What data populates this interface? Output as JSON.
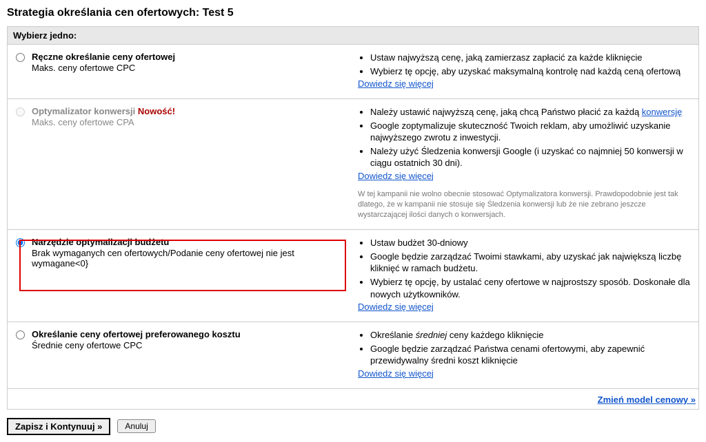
{
  "page_title": "Strategia określania cen ofertowych: Test 5",
  "panel_header": "Wybierz jedno:",
  "options": [
    {
      "heading": "Ręczne określanie ceny ofertowej",
      "sub": "Maks. ceny ofertowe CPC",
      "bullets": [
        "Ustaw najwyższą cenę, jaką zamierzasz zapłacić za każde kliknięcie",
        "Wybierz tę opcję, aby uzyskać maksymalną kontrolę nad każdą ceną ofertową"
      ],
      "learn_more": "Dowiedz się więcej"
    },
    {
      "heading": "Optymalizator konwersji",
      "new_badge": "Nowość!",
      "sub": "Maks. ceny ofertowe CPA",
      "bullet_pre": "Należy ustawić najwyższą cenę, jaką chcą Państwo płacić za każdą ",
      "bullet_link": "konwersję",
      "bullets_rest": [
        "Google zoptymalizuje skuteczność Twoich reklam, aby umożliwić uzyskanie najwyższego zwrotu z inwestycji.",
        "Należy użyć Śledzenia konwersji Google (i uzyskać co najmniej 50 konwersji w ciągu ostatnich 30 dni)."
      ],
      "learn_more": "Dowiedz się więcej",
      "note": "W tej kampanii nie wolno obecnie stosować Optymalizatora konwersji. Prawdopodobnie jest tak dlatego, że w kampanii nie stosuje się Śledzenia konwersji lub że nie zebrano jeszcze wystarczającej ilości danych o konwersjach."
    },
    {
      "heading": "Narzędzie optymalizacji budżetu",
      "sub": "Brak wymaganych cen ofertowych/Podanie ceny ofertowej nie jest wymagane<0}",
      "bullets": [
        "Ustaw budżet 30-dniowy",
        "Google będzie zarządzać Twoimi stawkami, aby uzyskać jak największą liczbę kliknięć w ramach budżetu.",
        "Wybierz tę opcję, by ustalać ceny ofertowe w najprostszy sposób. Doskonałe dla nowych użytkowników."
      ],
      "learn_more": "Dowiedz się więcej"
    },
    {
      "heading": "Określanie ceny ofertowej preferowanego kosztu",
      "sub": "Średnie ceny ofertowe CPC",
      "bullet_pre": "Określanie ",
      "bullet_italic": "średniej",
      "bullet_post": " ceny każdego kliknięcie",
      "bullets_rest": [
        "Google będzie zarządzać Państwa cenami ofertowymi, aby zapewnić przewidywalny średni koszt kliknięcie"
      ],
      "learn_more": "Dowiedz się więcej"
    }
  ],
  "change_model": "Zmień model cenowy »",
  "save_button": "Zapisz i Kontynuuj »",
  "cancel_button": "Anuluj"
}
